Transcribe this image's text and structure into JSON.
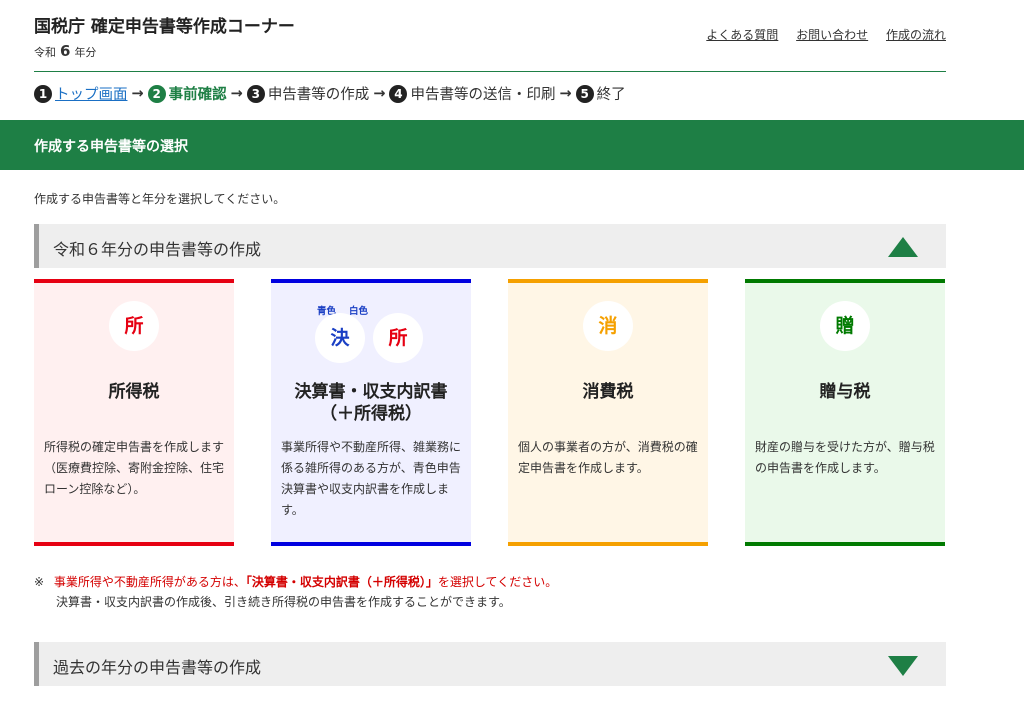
{
  "header": {
    "title": "国税庁 確定申告書等作成コーナー",
    "era_prefix": "令和",
    "era_year": "6",
    "era_suffix": "年分",
    "links": [
      "よくある質問",
      "お問い合わせ",
      "作成の流れ"
    ]
  },
  "steps": [
    {
      "num": "1",
      "label": "トップ画面"
    },
    {
      "num": "2",
      "label": "事前確認"
    },
    {
      "num": "3",
      "label": "申告書等の作成"
    },
    {
      "num": "4",
      "label": "申告書等の送信・印刷"
    },
    {
      "num": "5",
      "label": "終了"
    }
  ],
  "section_title": "作成する申告書等の選択",
  "instruction": "作成する申告書等と年分を選択してください。",
  "current_year_section": "令和６年分の申告書等の作成",
  "past_year_section": "過去の年分の申告書等の作成",
  "cards": [
    {
      "icon": "所",
      "title": "所得税",
      "description": "所得税の確定申告書を作成します（医療費控除、寄附金控除、住宅ローン控除など）。",
      "color": "#e60012",
      "bg": "#fff0f0"
    },
    {
      "icon1": "決",
      "icon2": "所",
      "label1": "青色",
      "label2": "白色",
      "title_line1": "決算書・収支内訳書",
      "title_line2": "（＋所得税）",
      "description": "事業所得や不動産所得、雑業務に係る雑所得のある方が、青色申告決算書や収支内訳書を作成します。",
      "color": "#0000e0",
      "bg": "#f0f0ff"
    },
    {
      "icon": "消",
      "title": "消費税",
      "description": "個人の事業者の方が、消費税の確定申告書を作成します。",
      "color": "#f5a000",
      "bg": "#fff6e6"
    },
    {
      "icon": "贈",
      "title": "贈与税",
      "description": "財産の贈与を受けた方が、贈与税の申告書を作成します。",
      "color": "#007a00",
      "bg": "#eaf9ea"
    }
  ],
  "note": {
    "mark": "※",
    "part1": "事業所得や不動産所得がある方は、",
    "emphasis": "「決算書・収支内訳書（＋所得税）」",
    "part2": "を選択してください。",
    "line2": "決算書・収支内訳書の作成後、引き続き所得税の申告書を作成することができます。"
  }
}
